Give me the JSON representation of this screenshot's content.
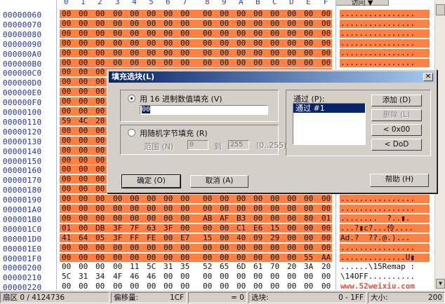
{
  "header": {
    "columns": [
      "0",
      "1",
      "2",
      "3",
      "4",
      "5",
      "6",
      "7",
      "8",
      "9",
      "A",
      "B",
      "C",
      "D",
      "E",
      "F"
    ],
    "visit_button": "访问 ▼"
  },
  "colors": {
    "selection": "#ff8040",
    "offset_text": "#2030a8",
    "title_bar": "#0a246a"
  },
  "rows": [
    {
      "offset": "00000060",
      "hex": "00 00 00 00 00 00 00 00 00 00 00 00 00 00 00 00",
      "ascii": "................",
      "selected": true
    },
    {
      "offset": "00000070",
      "hex": "00 00 00 00 00 00 00 00 00 00 00 00 00 00 00 00",
      "ascii": "................",
      "selected": true
    },
    {
      "offset": "00000080",
      "hex": "00 00 00 00 00 00 00 00 00 00 00 00 00 00 00 00",
      "ascii": "................",
      "selected": true
    },
    {
      "offset": "00000090",
      "hex": "00 00 00 00 00 00 00 00 00 00 00 00 00 00 00 00",
      "ascii": "................",
      "selected": true
    },
    {
      "offset": "000000A0",
      "hex": "00 00 00 00 00 00 00 00 00 00 00 00 00 00 00 00",
      "ascii": "................",
      "selected": true
    },
    {
      "offset": "000000B0",
      "hex": "00 00 00 00 00 00 00 00 00 00 00 00 00 00 00 00",
      "ascii": "................",
      "selected": true
    },
    {
      "offset": "000000C0",
      "hex": "00 00 00",
      "ascii": "",
      "selected": true
    },
    {
      "offset": "000000D0",
      "hex": "00 00 00",
      "ascii": "",
      "selected": true
    },
    {
      "offset": "000000E0",
      "hex": "00 00 00",
      "ascii": "",
      "selected": true
    },
    {
      "offset": "000000F0",
      "hex": "00 00 00",
      "ascii": "",
      "selected": true
    },
    {
      "offset": "00000100",
      "hex": "00 00 00",
      "ascii": "",
      "selected": true
    },
    {
      "offset": "00000110",
      "hex": "59 4C 20",
      "ascii": "",
      "selected": true
    },
    {
      "offset": "00000120",
      "hex": "00 00 00",
      "ascii": "",
      "selected": true
    },
    {
      "offset": "00000130",
      "hex": "00 00 00",
      "ascii": "",
      "selected": true
    },
    {
      "offset": "00000140",
      "hex": "00 00 00",
      "ascii": "",
      "selected": true
    },
    {
      "offset": "00000150",
      "hex": "00 00 00",
      "ascii": "",
      "selected": true
    },
    {
      "offset": "00000160",
      "hex": "00 00 00",
      "ascii": "",
      "selected": true
    },
    {
      "offset": "00000170",
      "hex": "00 00 00",
      "ascii": "",
      "selected": true
    },
    {
      "offset": "00000180",
      "hex": "00 00 00",
      "ascii": "",
      "selected": true
    },
    {
      "offset": "00000190",
      "hex": "00 00 00 00 00 00 00 00 00 00 00 00 00 00 00 00",
      "ascii": "................",
      "selected": true
    },
    {
      "offset": "000001A0",
      "hex": "00 00 00 00 00 00 00 00 00 00 00 00 00 00 00 00",
      "ascii": "................",
      "selected": true
    },
    {
      "offset": "000001B0",
      "hex": "00 00 00 00 00 00 00 00 AB AF B3 00 00 00 80 01",
      "ascii": "........  ?..▮.",
      "selected": true
    },
    {
      "offset": "000001C0",
      "hex": "01 00 DB 3F 7F 63 3F 00 00 00 C1 E6 15 00 00 00",
      "ascii": "...?▮c?...伶....",
      "selected": true
    },
    {
      "offset": "000001D0",
      "hex": "41 64 05 3F FF FE 00 E7 15 00 40 09 29 00 00 00",
      "ascii": "Ad.?  ??.@.)...",
      "selected": true
    },
    {
      "offset": "000001E0",
      "hex": "00 00 00 00 00 00 00 00 00 00 00 00 00 00 00 00",
      "ascii": "................",
      "selected": true
    },
    {
      "offset": "000001F0",
      "hex": "00 00 00 00 00 00 00 00 00 00 00 00 00 00 55 AA",
      "ascii": "..............U▮",
      "selected": true
    },
    {
      "offset": "00000200",
      "hex": "00 00 00 00 11 5C 31 35 52 65 6D 61 70 20 3A 20",
      "ascii": "......\\15Remap : ",
      "selected": false
    },
    {
      "offset": "00000210",
      "hex": "5C 31 34 4F 46 46 00 00 00 00 00 00 00 00 00 00",
      "ascii": "\\14OFF..........",
      "selected": false
    },
    {
      "offset": "00000220",
      "hex": "00 00 00 00 00 00 00 00 00 00 00 00 00 00 00 00",
      "ascii": "www.52weixiu.com",
      "selected": false,
      "watermark": true
    }
  ],
  "status": {
    "sector": "扇区 0 / 4124736",
    "offset_label": "偏移量:",
    "offset_value": "1CF",
    "eq_value": "= 0",
    "block_label": "选块:",
    "block_value": "0 - 1FF",
    "size_label": "大小:",
    "size_value": "200"
  },
  "dialog": {
    "title": "填充选块(L)",
    "close": "✕",
    "hex_radio": "用 16 进制数值填充 (V)",
    "hex_value": "00",
    "random_radio": "用随机字节填充 (R)",
    "range_label": "范围 (N)",
    "range_from": "0",
    "to_label": "到",
    "range_to": "255",
    "range_hint": "(0..255)",
    "pass_label": "通过 (P):",
    "pass_items": [
      "通过 #1"
    ],
    "add": "添加 (D)",
    "delete": "删除 (L)",
    "btn_0x00": "< 0x00",
    "btn_dod": "< DoD",
    "ok": "确定 (O)",
    "cancel": "取消 (A)",
    "help": "帮助 (H)"
  }
}
